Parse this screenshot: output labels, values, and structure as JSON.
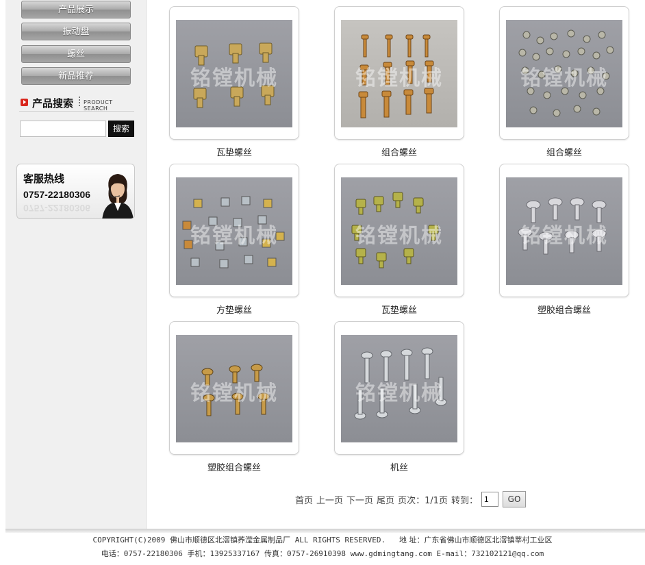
{
  "sidebar": {
    "nav": [
      {
        "label": "产品展示"
      },
      {
        "label": "振动盘"
      },
      {
        "label": "螺丝"
      },
      {
        "label": "新品推荐"
      }
    ],
    "search": {
      "title": "产品搜索",
      "subtitle": "PRODUCT SEARCH",
      "button_label": "搜索",
      "input_value": ""
    },
    "hotline": {
      "title": "客服热线",
      "phone": "0757-22180306"
    }
  },
  "products": [
    {
      "name": "瓦垫螺丝",
      "watermark": "铭镗机械",
      "screw_color": "#c9a85a"
    },
    {
      "name": "组合螺丝",
      "watermark": "铭镗机械",
      "screw_color": "#c88a3a"
    },
    {
      "name": "组合螺丝",
      "watermark": "铭镗机械",
      "screw_color": "#b9b7a8"
    },
    {
      "name": "方垫螺丝",
      "watermark": "铭镗机械",
      "screw_color": "#c9b86a"
    },
    {
      "name": "瓦垫螺丝",
      "watermark": "铭镗机械",
      "screw_color": "#b5b24a"
    },
    {
      "name": "塑胶组合螺丝",
      "watermark": "铭镗机械",
      "screw_color": "#d8d8dc"
    },
    {
      "name": "塑胶组合螺丝",
      "watermark": "铭镗机械",
      "screw_color": "#c79b48"
    },
    {
      "name": "机丝",
      "watermark": "铭镗机械",
      "screw_color": "#d6d9dc"
    }
  ],
  "pager": {
    "first": "首页",
    "prev": "上一页",
    "next": "下一页",
    "last": "尾页",
    "page_info": "页次：1/1页",
    "goto_label": "转到：",
    "page_value": "1",
    "go_label": "GO"
  },
  "footer": {
    "copyright": "COPYRIGHT(C)2009",
    "company": "佛山市顺德区北滘镇荞滢金属制品厂",
    "rights": "ALL RIGHTS RESERVED.",
    "address_label": "地 址：",
    "address": "广东省佛山市顺德区北滘镇莘村工业区",
    "tel_label": "电话：",
    "tel": "0757-22180306",
    "mobile_label": "手机：",
    "mobile": "13925337167",
    "fax_label": "传真：",
    "fax": "0757-26910398",
    "website": "www.gdmingtang.com",
    "email_label": "E-mail：",
    "email": "732102121@qq.com"
  },
  "colors": {
    "accent_red": "#d9261c",
    "nav_gray": "#a9a9a9",
    "photo_bg": "#9a9ba1"
  }
}
